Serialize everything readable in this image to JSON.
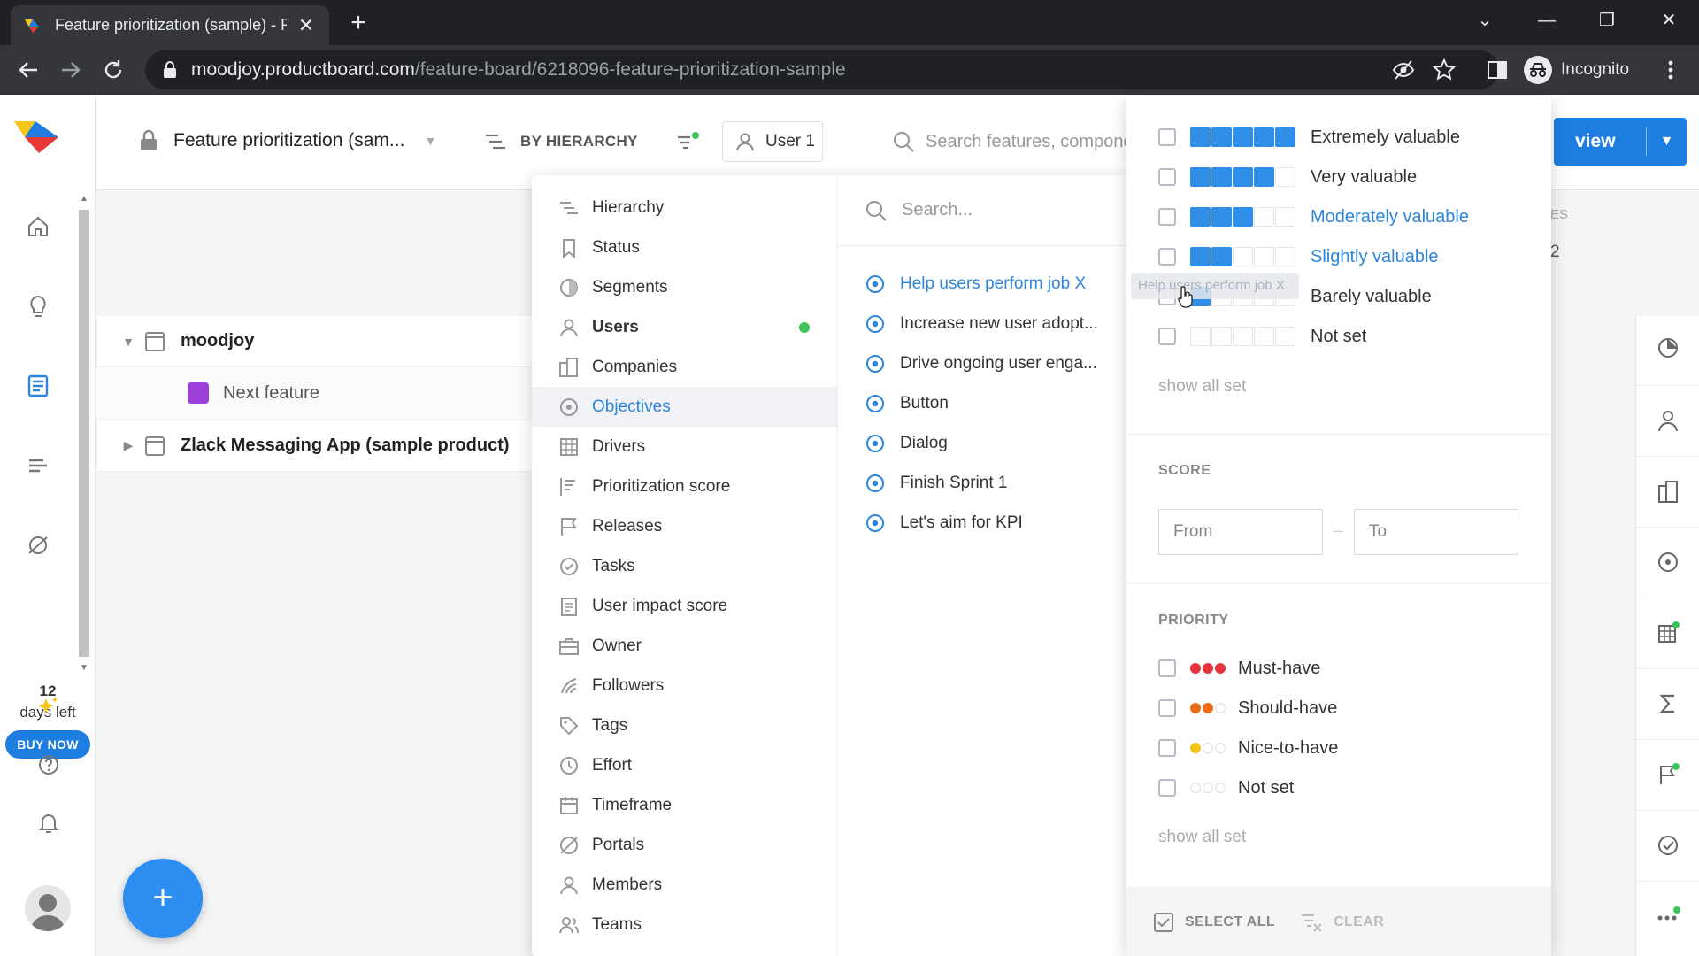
{
  "browser": {
    "tab_title": "Feature prioritization (sample) - P",
    "tab_close": "✕",
    "new_tab": "+",
    "url_host": "moodjoy.productboard.com",
    "url_path": "/feature-board/6218096-feature-prioritization-sample",
    "profile_label": "Incognito",
    "win_min": "—",
    "win_restore": "❐",
    "win_close": "✕",
    "tab_search": "⌄"
  },
  "rail": {
    "trial_days": "12",
    "trial_days_label": "days left",
    "buy_now": "BUY NOW"
  },
  "header": {
    "board_title": "Feature prioritization (sam...",
    "group_by": "BY HIERARCHY",
    "user_filter": "User 1",
    "search_placeholder": "Search features, compone",
    "view_button": "view"
  },
  "board": {
    "rows": [
      {
        "name": "moodjoy"
      },
      {
        "name": "Zlack Messaging App (sample product)"
      }
    ],
    "child": "Next feature",
    "bg_col_header": "ES",
    "bg_col_value": "2"
  },
  "filter_menu": {
    "categories": [
      {
        "label": "Hierarchy"
      },
      {
        "label": "Status"
      },
      {
        "label": "Segments"
      },
      {
        "label": "Users"
      },
      {
        "label": "Companies"
      },
      {
        "label": "Objectives"
      },
      {
        "label": "Drivers"
      },
      {
        "label": "Prioritization score"
      },
      {
        "label": "Releases"
      },
      {
        "label": "Tasks"
      },
      {
        "label": "User impact score"
      },
      {
        "label": "Owner"
      },
      {
        "label": "Followers"
      },
      {
        "label": "Tags"
      },
      {
        "label": "Effort"
      },
      {
        "label": "Timeframe"
      },
      {
        "label": "Portals"
      },
      {
        "label": "Members"
      },
      {
        "label": "Teams"
      }
    ],
    "search_placeholder": "Search...",
    "objectives": [
      {
        "label": "Help users perform job X"
      },
      {
        "label": "Increase new user adopt..."
      },
      {
        "label": "Drive ongoing user enga..."
      },
      {
        "label": "Button"
      },
      {
        "label": "Dialog"
      },
      {
        "label": "Finish Sprint 1"
      },
      {
        "label": "Let's aim for KPI"
      }
    ]
  },
  "value_panel": {
    "values": [
      {
        "label": "Extremely valuable",
        "level": 5
      },
      {
        "label": "Very valuable",
        "level": 4
      },
      {
        "label": "Moderately valuable",
        "level": 3
      },
      {
        "label": "Slightly valuable",
        "level": 2
      },
      {
        "label": "Barely valuable",
        "level": 1
      },
      {
        "label": "Not set",
        "level": 0
      }
    ],
    "show_all_1": "show all set",
    "score_title": "SCORE",
    "score_from": "From",
    "score_to": "To",
    "score_dash": "–",
    "priority_title": "PRIORITY",
    "priorities": [
      {
        "label": "Must-have",
        "count": 3,
        "color": "#e5343d"
      },
      {
        "label": "Should-have",
        "count": 2,
        "color": "#ec6b1b"
      },
      {
        "label": "Nice-to-have",
        "count": 1,
        "color": "#f2c318"
      },
      {
        "label": "Not set",
        "count": 0,
        "color": "#dddddd"
      }
    ],
    "show_all_2": "show all set",
    "select_all": "SELECT ALL",
    "clear": "CLEAR",
    "drag_ghost": "Help users perform job X"
  },
  "colors": {
    "accent": "#1e7de0",
    "value_bar": "#2f8fe8",
    "online_dot": "#3cc55a",
    "feature_swatch": "#9b3fd8"
  }
}
